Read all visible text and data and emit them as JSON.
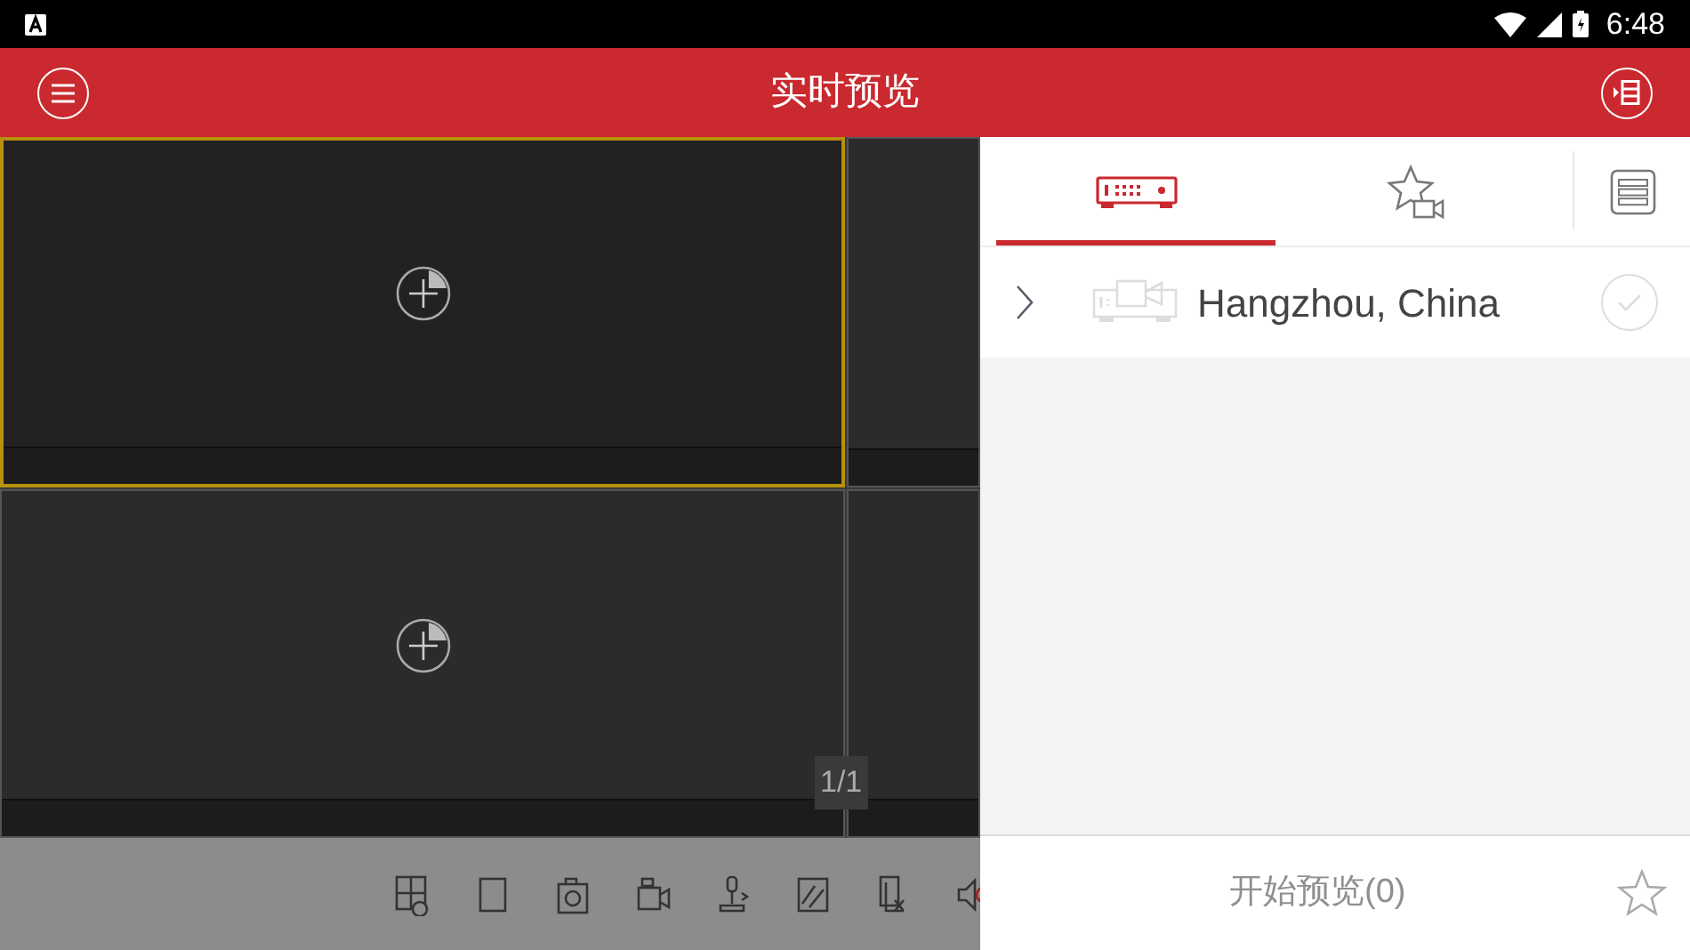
{
  "status_bar": {
    "time": "6:48"
  },
  "header": {
    "title": "实时预览"
  },
  "video_grid": {
    "cells": [
      {
        "selected": true
      },
      {
        "selected": false
      },
      {
        "selected": false
      },
      {
        "selected": false
      }
    ],
    "page_indicator": "1/1"
  },
  "panel_tabs": [
    {
      "kind": "device",
      "selected": true
    },
    {
      "kind": "favorites",
      "selected": false
    },
    {
      "kind": "list",
      "selected": false
    }
  ],
  "devices": [
    {
      "name": "Hangzhou, China",
      "checked": false
    }
  ],
  "footer": {
    "start_button": "开始预览(0)"
  }
}
